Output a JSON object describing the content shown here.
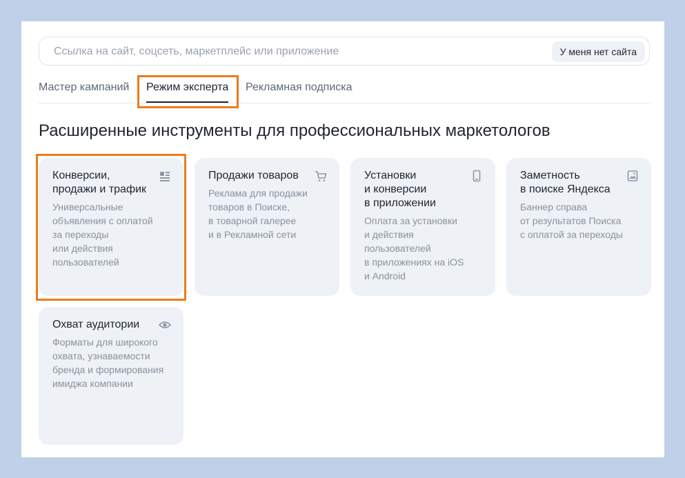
{
  "search": {
    "placeholder": "Ссылка на сайт, соцсеть, маркетплейс или приложение",
    "value": "",
    "no_site_button": "У меня нет сайта"
  },
  "tabs": [
    {
      "label": "Мастер кампаний",
      "active": false
    },
    {
      "label": "Режим эксперта",
      "active": true
    },
    {
      "label": "Рекламная подписка",
      "active": false
    }
  ],
  "heading": "Расширенные инструменты для профессиональных маркетологов",
  "cards": [
    {
      "title": "Конверсии,\nпродажи и трафик",
      "desc": "Универсальные\nобъявления с оплатой\nза переходы\nили действия\nпользователей",
      "icon": "list-icon"
    },
    {
      "title": "Продажи товаров",
      "desc": "Реклама для продажи\nтоваров в Поиске,\nв товарной галерее\nи в Рекламной сети",
      "icon": "cart-icon"
    },
    {
      "title": "Установки\nи конверсии\nв приложении",
      "desc": "Оплата за установки\nи действия\nпользователей\nв приложениях на iOS\nи Android",
      "icon": "phone-icon"
    },
    {
      "title": "Заметность\nв поиске Яндекса",
      "desc": "Баннер справа\nот результатов Поиска\nс оплатой за переходы",
      "icon": "image-icon"
    },
    {
      "title": "Охват аудитории",
      "desc": "Форматы для широкого\nохвата, узнаваемости\nбренда и формирования\nимиджа компании",
      "icon": "eye-icon"
    }
  ],
  "colors": {
    "background": "#bfd1e8",
    "card_background": "#eef1f6",
    "highlight": "#ef7a1a",
    "text_primary": "#1f2430",
    "text_secondary": "#8a919e"
  }
}
